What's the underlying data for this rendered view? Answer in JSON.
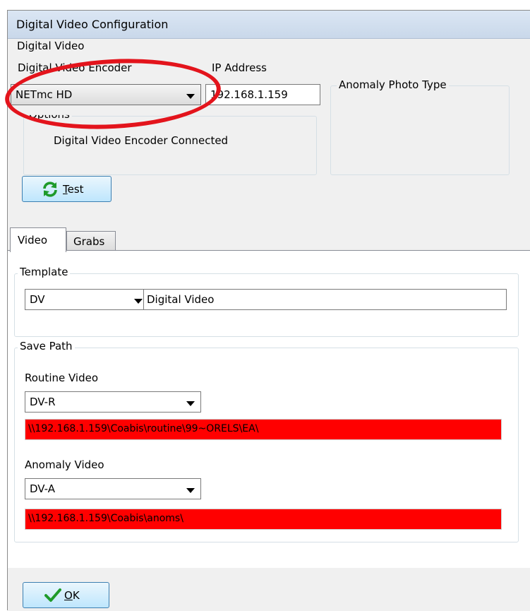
{
  "window": {
    "title": "Digital Video Configuration"
  },
  "digital_video": {
    "group_label": "Digital Video",
    "encoder_label": "Digital Video Encoder",
    "encoder_value": "NETmc HD",
    "ip_label": "IP Address",
    "ip_value": "192.168.1.159",
    "options_label": "Options",
    "status_text": "Digital Video Encoder Connected",
    "anomaly_photo_label": "Anomaly Photo Type",
    "test_button": {
      "mnemonic": "T",
      "rest": "est"
    }
  },
  "tabs": [
    {
      "label": "Video",
      "active": true
    },
    {
      "label": "Grabs",
      "active": false
    }
  ],
  "template": {
    "label": "Template",
    "code": "DV",
    "name": "Digital Video"
  },
  "save_path": {
    "label": "Save Path",
    "routine": {
      "label": "Routine Video",
      "value": "DV-R",
      "path": "\\\\192.168.1.159\\Coabis\\routine\\99~ORELS\\EA\\"
    },
    "anomaly": {
      "label": "Anomaly Video",
      "value": "DV-A",
      "path": "\\\\192.168.1.159\\Coabis\\anoms\\"
    }
  },
  "ok_button": {
    "mnemonic": "O",
    "rest": "K"
  },
  "colors": {
    "path_highlight": "#ff0000",
    "annotation_circle": "#e3141c",
    "refresh_icon": "#1e9a2a",
    "check_icon": "#1e9a2a"
  },
  "icons": {
    "test": "refresh-icon",
    "ok": "checkmark-icon"
  }
}
